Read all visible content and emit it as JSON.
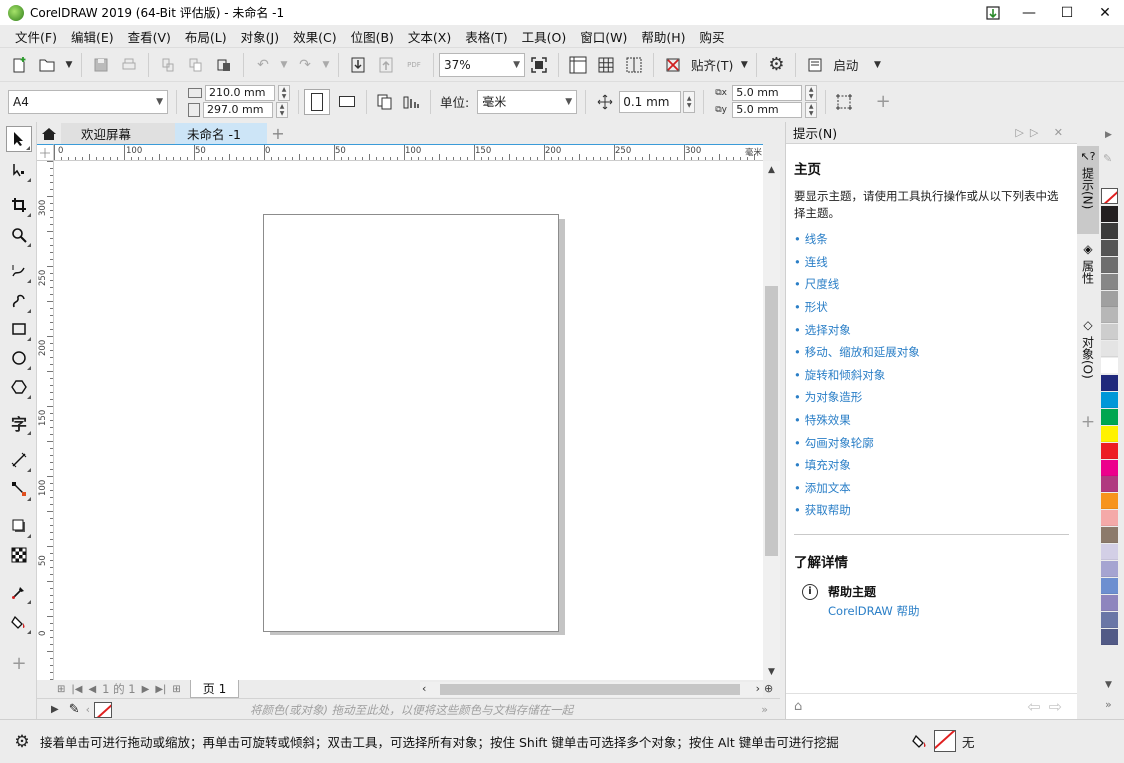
{
  "window": {
    "title": "CorelDRAW 2019 (64-Bit 评估版) - 未命名 -1",
    "controls": {
      "minimize": "—",
      "maximize": "☐",
      "close": "✕"
    }
  },
  "menu": [
    "文件(F)",
    "编辑(E)",
    "查看(V)",
    "布局(L)",
    "对象(J)",
    "效果(C)",
    "位图(B)",
    "文本(X)",
    "表格(T)",
    "工具(O)",
    "窗口(W)",
    "帮助(H)",
    "购买"
  ],
  "toolbar": {
    "zoom_value": "37%",
    "snap_label": "贴齐(T)",
    "launch_label": "启动",
    "pdf_label": "PDF"
  },
  "propertybar": {
    "page_size": "A4",
    "width": "210.0 mm",
    "height": "297.0 mm",
    "units_label": "单位:",
    "units_value": "毫米",
    "nudge": "0.1 mm",
    "dup_x": "5.0 mm",
    "dup_y": "5.0 mm"
  },
  "tabs": {
    "welcome": "欢迎屏幕",
    "document": "未命名 -1",
    "add": "+"
  },
  "ruler": {
    "h_labels": [
      "0",
      "100",
      "50",
      "0",
      "50",
      "100",
      "150",
      "200",
      "250",
      "300"
    ],
    "unit": "毫米",
    "v_labels": [
      "300",
      "250",
      "200",
      "150",
      "100",
      "50",
      "0"
    ]
  },
  "pagenav": {
    "counter": "1 的 1",
    "page_tab": "页 1"
  },
  "document_palette": {
    "hint": "将颜色(或对象) 拖动至此处，以便将这些颜色与文档存储在一起"
  },
  "docker": {
    "header": "提示(N)",
    "title": "主页",
    "description": "要显示主题，请使用工具执行操作或从以下列表中选择主题。",
    "links": [
      "线条",
      "连线",
      "尺度线",
      "形状",
      "选择对象",
      "移动、缩放和延展对象",
      "旋转和倾斜对象",
      "为对象造形",
      "特殊效果",
      "勾画对象轮廓",
      "填充对象",
      "添加文本",
      "获取帮助"
    ],
    "learn_more": "了解详情",
    "help_topic": "帮助主题",
    "help_link": "CorelDRAW 帮助",
    "side_tabs": [
      "提示(N)",
      "属性",
      "对象(O)"
    ]
  },
  "palette": {
    "colors": [
      "#231f20",
      "#3b3b3b",
      "#555555",
      "#6e6e6e",
      "#878787",
      "#a0a0a0",
      "#b7b7b7",
      "#cdcdcd",
      "#e4e4e4",
      "#ffffff",
      "#20297c",
      "#0097d8",
      "#00a650",
      "#fff200",
      "#ed1c24",
      "#ec008c",
      "#b03a80",
      "#f7941d",
      "#f4a9a8",
      "#8c7a6b",
      "#d3cfe6",
      "#a5a4d1",
      "#6d8fd0",
      "#8e85be",
      "#6a76a6",
      "#525a86"
    ]
  },
  "status": {
    "message": "接着单击可进行拖动或缩放；再单击可旋转或倾斜；双击工具，可选择所有对象；按住 Shift 键单击可选择多个对象；按住 Alt 键单击可进行挖掘",
    "fill_label": "无"
  }
}
